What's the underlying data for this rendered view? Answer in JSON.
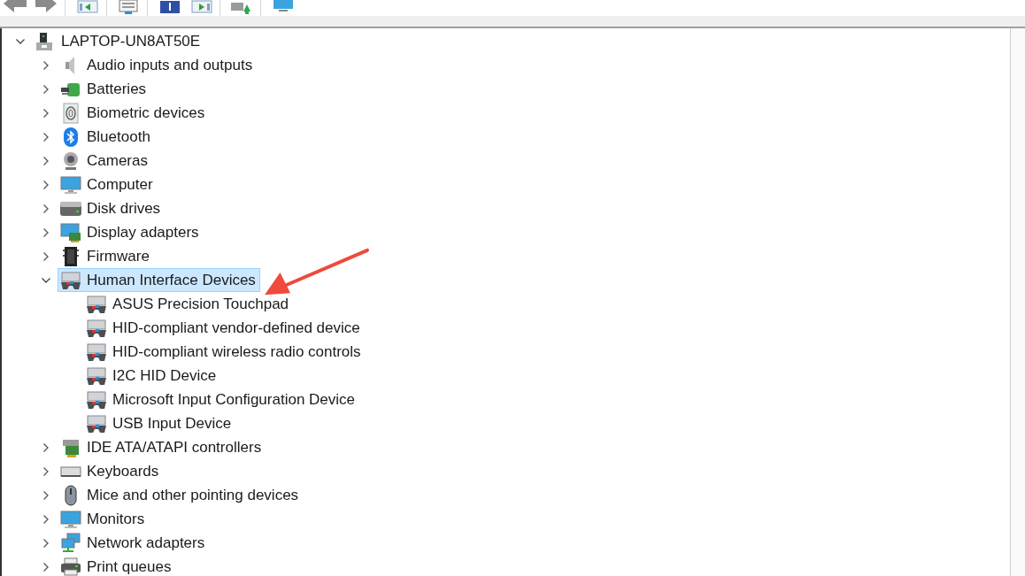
{
  "tree": {
    "label": "LAPTOP-UN8AT50E",
    "kind": "root",
    "expanded": true,
    "selected": false,
    "children": [
      {
        "label": "Audio inputs and outputs",
        "kind": "audio",
        "expanded": false,
        "selected": false
      },
      {
        "label": "Batteries",
        "kind": "battery",
        "expanded": false,
        "selected": false
      },
      {
        "label": "Biometric devices",
        "kind": "biometric",
        "expanded": false,
        "selected": false
      },
      {
        "label": "Bluetooth",
        "kind": "bluetooth",
        "expanded": false,
        "selected": false
      },
      {
        "label": "Cameras",
        "kind": "camera",
        "expanded": false,
        "selected": false
      },
      {
        "label": "Computer",
        "kind": "computer",
        "expanded": false,
        "selected": false
      },
      {
        "label": "Disk drives",
        "kind": "disk",
        "expanded": false,
        "selected": false
      },
      {
        "label": "Display adapters",
        "kind": "display",
        "expanded": false,
        "selected": false
      },
      {
        "label": "Firmware",
        "kind": "firmware",
        "expanded": false,
        "selected": false
      },
      {
        "label": "Human Interface Devices",
        "kind": "hid",
        "expanded": true,
        "selected": true,
        "children": [
          {
            "label": "ASUS Precision Touchpad",
            "kind": "hid",
            "selected": false
          },
          {
            "label": "HID-compliant vendor-defined device",
            "kind": "hid",
            "selected": false
          },
          {
            "label": "HID-compliant wireless radio controls",
            "kind": "hid",
            "selected": false
          },
          {
            "label": "I2C HID Device",
            "kind": "hid",
            "selected": false
          },
          {
            "label": "Microsoft Input Configuration Device",
            "kind": "hid",
            "selected": false
          },
          {
            "label": "USB Input Device",
            "kind": "hid",
            "selected": false
          }
        ]
      },
      {
        "label": "IDE ATA/ATAPI controllers",
        "kind": "ide",
        "expanded": false,
        "selected": false
      },
      {
        "label": "Keyboards",
        "kind": "keyboard",
        "expanded": false,
        "selected": false
      },
      {
        "label": "Mice and other pointing devices",
        "kind": "mouse",
        "expanded": false,
        "selected": false
      },
      {
        "label": "Monitors",
        "kind": "monitor",
        "expanded": false,
        "selected": false
      },
      {
        "label": "Network adapters",
        "kind": "network",
        "expanded": false,
        "selected": false
      },
      {
        "label": "Print queues",
        "kind": "printer",
        "expanded": false,
        "selected": false
      }
    ]
  }
}
